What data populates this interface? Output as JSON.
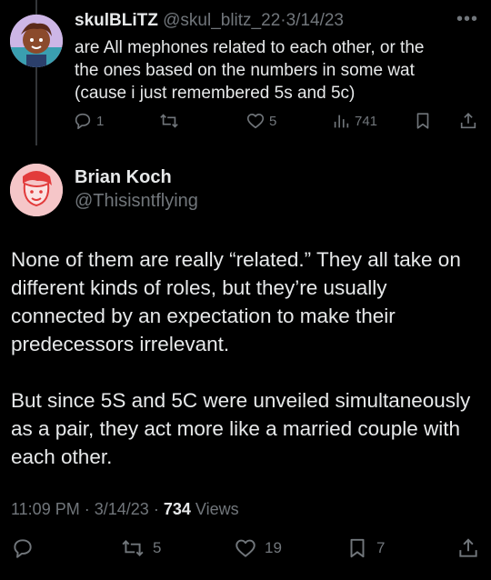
{
  "reply": {
    "display_name": "skulBLiTZ",
    "handle": "@skul_blitz_22",
    "separator": "·",
    "date": "3/14/23",
    "text_lines": [
      "are All mephones related to each other, or the",
      "the ones based on the numbers in some wat",
      "(cause i just remembered 5s and 5c)"
    ],
    "replies": "1",
    "retweets": "",
    "likes": "5",
    "views": "741"
  },
  "tweet": {
    "display_name": "Brian Koch",
    "handle": "@Thisisntflying",
    "paragraphs": [
      "None of them are really “related.” They all take on different kinds of roles, but they’re usually connected by an expectation to make their predecessors irrelevant.",
      "But since 5S and 5C were unveiled simultaneously as a pair, they act more like a married couple with each other."
    ],
    "time": "11:09 PM",
    "date": "3/14/23",
    "separator": "·",
    "views_count": "734",
    "views_label": "Views",
    "retweets": "5",
    "likes": "19",
    "bookmarks": "7"
  },
  "colors": {
    "background": "#000000",
    "text": "#e7e9ea",
    "muted": "#71767b",
    "thread_line": "#333639"
  },
  "icons": {
    "reply": "reply-icon",
    "retweet": "retweet-icon",
    "like": "heart-icon",
    "views": "views-icon",
    "bookmark": "bookmark-icon",
    "share": "share-icon",
    "more": "more-icon"
  }
}
